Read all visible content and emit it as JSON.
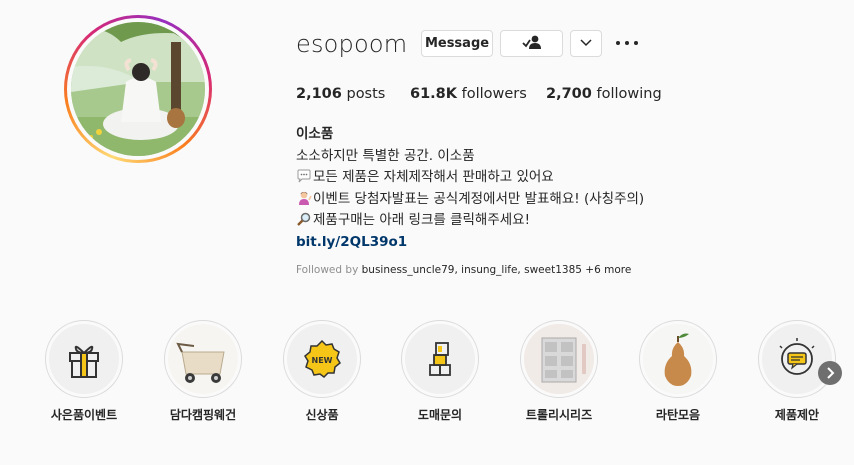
{
  "profile": {
    "username": "esopoom",
    "message_label": "Message",
    "posts_count": "2,106",
    "posts_label": "posts",
    "followers_count": "61.8K",
    "followers_label": "followers",
    "following_count": "2,700",
    "following_label": "following"
  },
  "bio": {
    "name": "이소품",
    "line1": "소소하지만 특별한 공간. 이소품",
    "line2": "모든 제품은 자체제작해서 판매하고 있어요",
    "line3": "이벤트 당첨자발표는 공식계정에서만 발표해요! (사칭주의)",
    "line4": "제품구매는 아래 링크를 클릭해주세요!",
    "link": "bit.ly/2QL39o1"
  },
  "followed_by": {
    "prefix": "Followed by",
    "user1": "business_uncle79",
    "user2": "insung_life",
    "user3": "sweet1385",
    "more": "+6 more"
  },
  "highlights": [
    {
      "label": "사은품이벤트",
      "icon": "gift-icon"
    },
    {
      "label": "담다캠핑웨건",
      "icon": "wagon-icon"
    },
    {
      "label": "신상품",
      "icon": "new-badge-icon"
    },
    {
      "label": "도매문의",
      "icon": "boxes-icon"
    },
    {
      "label": "트롤리시리즈",
      "icon": "trolley-icon"
    },
    {
      "label": "라탄모음",
      "icon": "rattan-pear-icon"
    },
    {
      "label": "제품제안",
      "icon": "suggestion-icon"
    }
  ],
  "icons": {
    "follow": "person-check-icon",
    "dropdown": "chevron-down-icon",
    "more": "more-options-icon",
    "next": "chevron-right-icon"
  },
  "colors": {
    "link": "#00376b",
    "muted": "#8e8e8e",
    "accent_yellow": "#f5c518"
  }
}
